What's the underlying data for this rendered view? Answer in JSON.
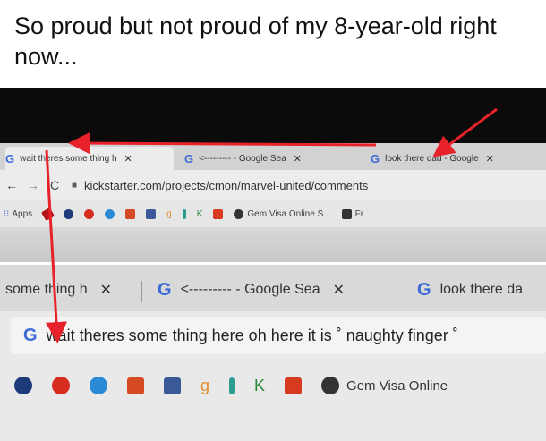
{
  "caption": "So proud but not proud of my 8-year-old right now...",
  "top_browser": {
    "tabs": [
      {
        "label": "wait theres some thing h",
        "close": "✕"
      },
      {
        "label": "<--------- - Google Sea",
        "close": "✕"
      },
      {
        "label": "look there dad - Google",
        "close": "✕"
      }
    ],
    "url": "kickstarter.com/projects/cmon/marvel-united/comments",
    "bookmarks": {
      "apps_label": "Apps",
      "gem_label": "Gem Visa Online S...",
      "fr_label": "Fr",
      "g_label": "g",
      "k_label": "K"
    }
  },
  "bottom_browser": {
    "tabs": [
      {
        "label": "some thing h",
        "close": "✕"
      },
      {
        "label": "<--------- - Google Sea",
        "close": "✕"
      },
      {
        "label": "look there da",
        "close": ""
      }
    ],
    "omnibox": "wait theres some thing here oh here it is ˚ naughty finger ˚",
    "bookmarks": {
      "gem_label": "Gem Visa Online",
      "g_label": "g",
      "k_label": "K"
    }
  },
  "colors": {
    "arrow": "#e8222a",
    "google_blue": "#3c6bd4"
  }
}
